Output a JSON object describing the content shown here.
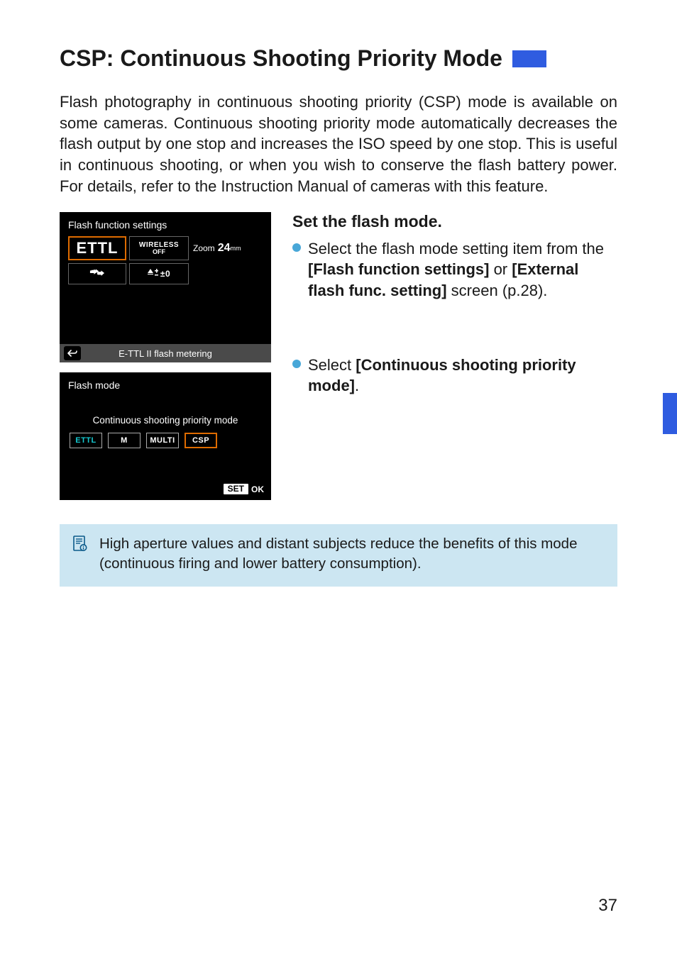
{
  "title": "CSP: Continuous Shooting Priority Mode",
  "intro": "Flash photography in continuous shooting priority (CSP) mode is available on some cameras. Continuous shooting priority mode automatically decreases the flash output by one stop and increases the ISO speed by one stop. This is useful in continuous shooting, or when you wish to conserve the flash battery power. For details, refer to the Instruction Manual of cameras with this feature.",
  "shot1": {
    "title": "Flash function settings",
    "ettl": "ETTL",
    "wireless_l1": "WIRELESS",
    "wireless_l2": "OFF",
    "zoom_label": "Zoom",
    "zoom_value": "24",
    "zoom_unit": "mm",
    "expcomp": "±0",
    "footer": "E-TTL II flash metering"
  },
  "shot2": {
    "title": "Flash mode",
    "subtitle": "Continuous shooting priority mode",
    "modes": {
      "ettl": "ETTL",
      "m": "M",
      "multi": "MULTI",
      "csp": "CSP"
    },
    "set": "SET",
    "ok": "OK"
  },
  "step": {
    "title": "Set the flash mode.",
    "b1_pre": "Select the flash mode setting item from the ",
    "b1_bold1": "[Flash function settings]",
    "b1_mid": " or ",
    "b1_bold2": "[External flash func. setting]",
    "b1_post": " screen (p.28).",
    "b2_pre": "Select ",
    "b2_bold": "[Continuous shooting priority mode]",
    "b2_post": "."
  },
  "note": "High aperture values and distant subjects reduce the benefits of this mode (continuous firing and lower battery consumption).",
  "page_number": "37"
}
